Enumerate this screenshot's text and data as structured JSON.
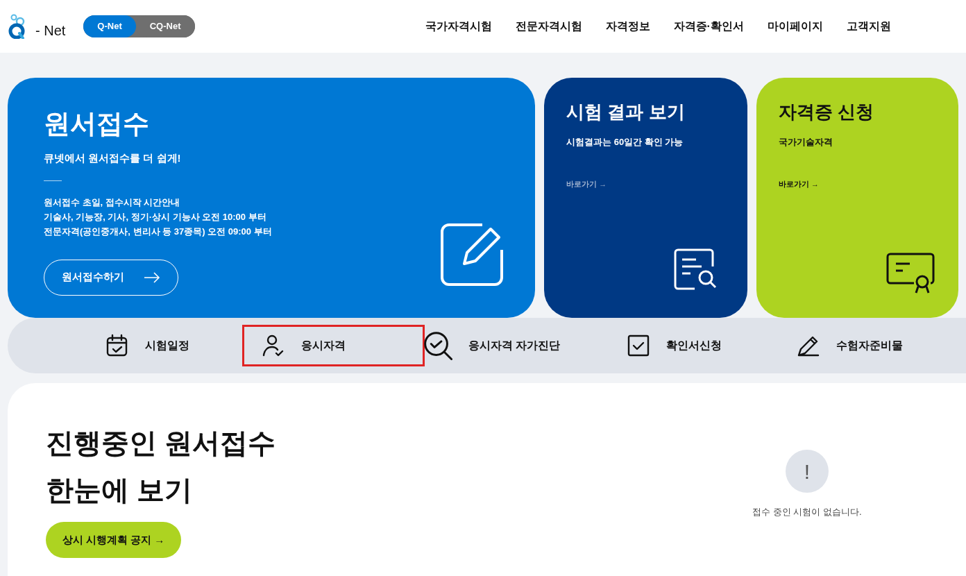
{
  "logo": {
    "text": "- Net"
  },
  "site_toggle": [
    {
      "label": "Q-Net",
      "selected": true
    },
    {
      "label": "CQ-Net",
      "selected": false
    }
  ],
  "nav": [
    "국가자격시험",
    "전문자격시험",
    "자격정보",
    "자격증·확인서",
    "마이페이지",
    "고객지원"
  ],
  "main_card": {
    "title": "원서접수",
    "subtitle": "큐넷에서 원서접수를 더 쉽게!",
    "lines": [
      "원서접수 초일, 접수시작 시간안내",
      "기술사, 기능장, 기사, 정기·상시 기능사 오전 10:00 부터",
      "전문자격(공인중개사, 변리사 등 37종목) 오전 09:00 부터"
    ],
    "button": "원서접수하기"
  },
  "side_cards": [
    {
      "kind": "result",
      "title": "시험 결과 보기",
      "subtitle": "시험결과는 60일간 확인 가능",
      "link": "바로가기 →"
    },
    {
      "kind": "certificate",
      "title": "자격증 신청",
      "subtitle": "국가기술자격",
      "link": "바로가기 →"
    }
  ],
  "quick_links": [
    {
      "kind": "calendar",
      "label": "시험일정",
      "highlighted": false
    },
    {
      "kind": "person",
      "label": "응시자격",
      "highlighted": true
    },
    {
      "kind": "search",
      "label": "응시자격 자가진단",
      "highlighted": false
    },
    {
      "kind": "checkbox",
      "label": "확인서신청",
      "highlighted": false
    },
    {
      "kind": "pencil",
      "label": "수험자준비물",
      "highlighted": false
    }
  ],
  "ongoing": {
    "title_lines": [
      "진행중인 원서접수",
      "한눈에 보기"
    ],
    "button": "상시 시행계획 공지 →",
    "empty_icon": "!",
    "empty_message": "접수 중인 시험이 없습니다."
  }
}
